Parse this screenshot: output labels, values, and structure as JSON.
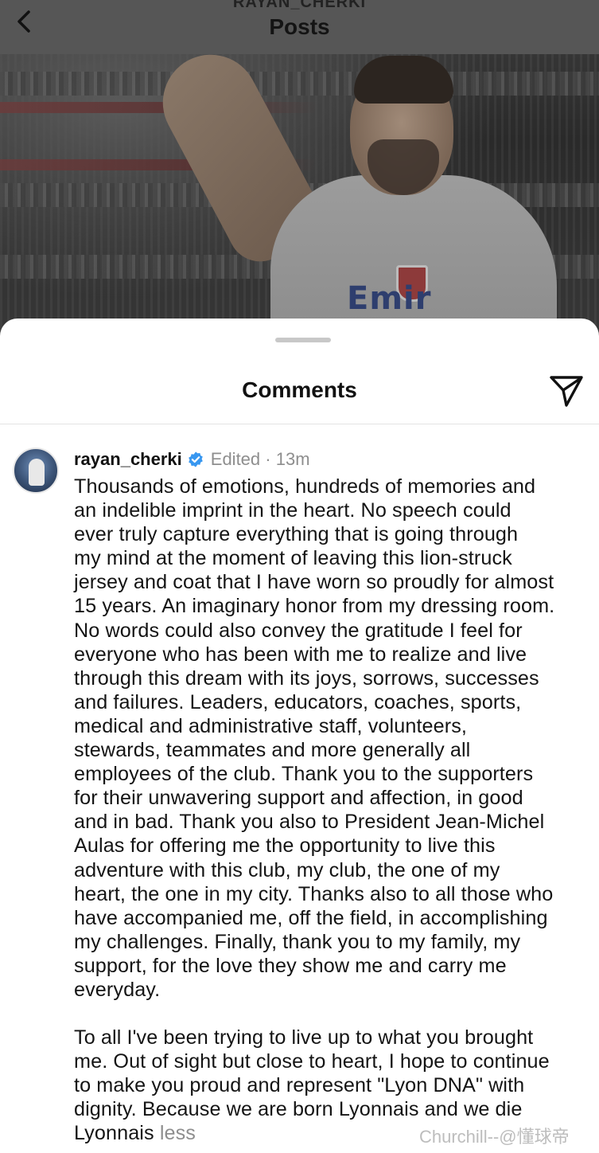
{
  "header": {
    "account_name": "RAYAN_CHERKI",
    "title": "Posts",
    "back_icon": "chevron-left-icon"
  },
  "post_image": {
    "shirt_text": "Emir"
  },
  "comments_sheet": {
    "title": "Comments",
    "share_icon": "paper-plane-icon",
    "comment": {
      "username": "rayan_cherki",
      "verified_icon": "verified-badge-icon",
      "verified_color": "#3897f0",
      "edited_label": "Edited",
      "separator": " · ",
      "time": "13m",
      "lines": [
        "Thousands of emotions, hundreds of memories and",
        "an indelible imprint in the heart. No speech could",
        "ever truly capture everything that is going through",
        "my mind at the moment of leaving this lion-struck",
        "jersey and coat that I have worn so proudly for almost",
        "15 years. An imaginary honor from my dressing room.",
        "No words could also convey the gratitude I feel for",
        "everyone who has been with me to realize and live",
        "through this dream with its joys, sorrows, successes",
        "and failures. Leaders, educators, coaches, sports,",
        "medical and administrative staff, volunteers,",
        "stewards, teammates and more generally all",
        "employees of the club. Thank you to the supporters",
        "for their unwavering support and affection, in good",
        "and in bad. Thank you also to President Jean-Michel",
        "Aulas for offering me the opportunity to live this",
        "adventure with this club, my club, the one of my",
        "heart, the one in my city. Thanks also to all those who",
        "have accompanied me, off the field, in accomplishing",
        "my challenges. Finally, thank you to my family, my",
        "support, for the love they show me and carry me",
        "everyday."
      ],
      "lines2": [
        "To all I've been trying to live up to what you brought",
        "me. Out of sight but close to heart, I hope to continue",
        "to make you proud and represent \"Lyon DNA\" with",
        "dignity. Because we are born Lyonnais and we die"
      ],
      "last_line": "Lyonnais",
      "less_label": "less"
    }
  },
  "watermark": "Churchill--@懂球帝"
}
